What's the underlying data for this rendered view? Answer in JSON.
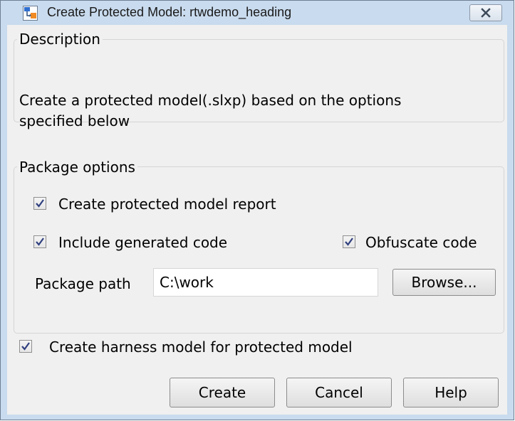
{
  "window": {
    "title": "Create Protected Model: rtwdemo_heading"
  },
  "description": {
    "legend": "Description",
    "line1": "Create a protected model(.slxp) based on the options",
    "line2": "specified below"
  },
  "package": {
    "legend": "Package options",
    "create_report": {
      "label": "Create protected model report",
      "checked": true
    },
    "include_code": {
      "label": "Include generated code",
      "checked": true
    },
    "obfuscate": {
      "label": "Obfuscate code",
      "checked": true
    },
    "path_label": "Package path",
    "path_value": "C:\\work",
    "browse_label": "Browse..."
  },
  "harness": {
    "label": "Create harness model for protected model",
    "checked": true
  },
  "buttons": {
    "create": "Create",
    "cancel": "Cancel",
    "help": "Help"
  },
  "colors": {
    "titlebar": "#c9dbee",
    "client": "#f0f0f0",
    "checkmark": "#2f3f7f"
  }
}
